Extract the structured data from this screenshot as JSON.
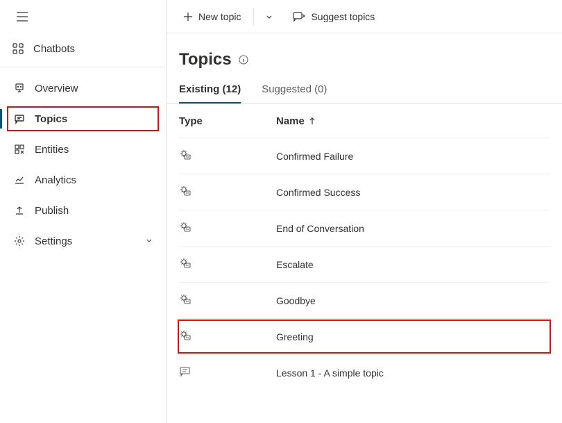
{
  "sidebar": {
    "chatbots_label": "Chatbots",
    "items": [
      {
        "label": "Overview"
      },
      {
        "label": "Topics"
      },
      {
        "label": "Entities"
      },
      {
        "label": "Analytics"
      },
      {
        "label": "Publish"
      },
      {
        "label": "Settings"
      }
    ]
  },
  "toolbar": {
    "new_topic_label": "New topic",
    "suggest_topics_label": "Suggest topics"
  },
  "page": {
    "title": "Topics"
  },
  "tabs": {
    "existing_label": "Existing (12)",
    "suggested_label": "Suggested (0)"
  },
  "table": {
    "headers": {
      "type": "Type",
      "name": "Name"
    },
    "rows": [
      {
        "name": "Confirmed Failure",
        "system": true
      },
      {
        "name": "Confirmed Success",
        "system": true
      },
      {
        "name": "End of Conversation",
        "system": true
      },
      {
        "name": "Escalate",
        "system": true
      },
      {
        "name": "Goodbye",
        "system": true
      },
      {
        "name": "Greeting",
        "system": true
      },
      {
        "name": "Lesson 1 - A simple topic",
        "system": false
      }
    ]
  }
}
